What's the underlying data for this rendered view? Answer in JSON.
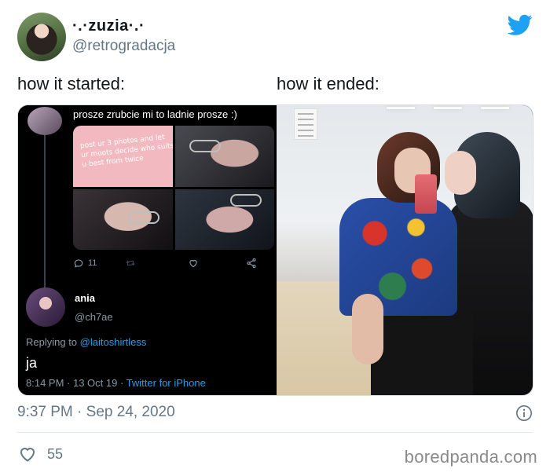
{
  "author": {
    "display_name": "·.·zuzia·.·",
    "handle": "@retrogradacja"
  },
  "icons": {
    "brand": "twitter-bird-icon",
    "info": "info-circle-icon",
    "like": "heart-icon",
    "reply": "comment-icon",
    "retweet": "retweet-icon",
    "share": "share-icon"
  },
  "colors": {
    "twitter_blue": "#1da1f2",
    "muted_text": "#657786"
  },
  "captions": {
    "left": "how it started:",
    "right": "how it ended:"
  },
  "embedded_tweet": {
    "reply_text": "prosze zrubcie mi to ladnie prosze :)",
    "pink_image_text": "post ur 3 photos and let ur moots decide who suits u best from twice",
    "reply_count": "11",
    "reply": {
      "name": "ania",
      "handle": "@ch7ae",
      "replying_prefix": "Replying to",
      "replying_handle": "@laitoshirtless",
      "text": "ja",
      "meta_time": "8:14 PM · 13 Oct 19 ·",
      "meta_source": "Twitter for iPhone"
    }
  },
  "tweet": {
    "timestamp": "9:37 PM · Sep 24, 2020",
    "likes": "55"
  },
  "watermark": "boredpanda.com"
}
